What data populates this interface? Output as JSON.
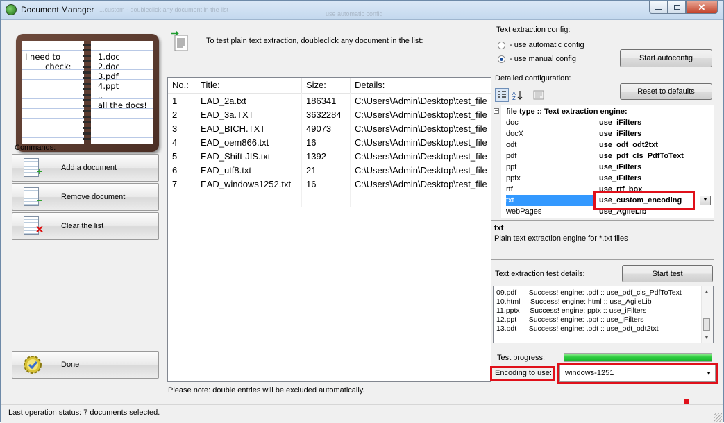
{
  "window": {
    "title": "Document Manager",
    "ghost_title_text": "...custom - doubleclick any document in the list",
    "ghost_option_text": "use automatic config"
  },
  "book": {
    "left_lines": [
      "I need to",
      "check:"
    ],
    "right_lines": [
      "1.doc",
      "2.doc",
      "3.pdf",
      "4.ppt",
      "..",
      "all the docs!"
    ]
  },
  "commands": {
    "label": "Commands:",
    "buttons": [
      {
        "label": "Add a document",
        "icon": "add-document-icon"
      },
      {
        "label": "Remove document",
        "icon": "remove-document-icon"
      },
      {
        "label": "Clear the list",
        "icon": "clear-list-icon"
      }
    ],
    "done_label": "Done"
  },
  "hint": "To test plain text extraction, doubleclick any document in the list:",
  "table": {
    "columns": [
      "No.:",
      "Title:",
      "Size:",
      "Details:"
    ],
    "rows": [
      {
        "no": "1",
        "title": "EAD_2a.txt",
        "size": "186341",
        "details": "C:\\Users\\Admin\\Desktop\\test_file"
      },
      {
        "no": "2",
        "title": "EAD_3a.TXT",
        "size": "3632284",
        "details": "C:\\Users\\Admin\\Desktop\\test_file"
      },
      {
        "no": "3",
        "title": "EAD_BICH.TXT",
        "size": "49073",
        "details": "C:\\Users\\Admin\\Desktop\\test_file"
      },
      {
        "no": "4",
        "title": "EAD_oem866.txt",
        "size": "16",
        "details": "C:\\Users\\Admin\\Desktop\\test_file"
      },
      {
        "no": "5",
        "title": "EAD_Shift-JIS.txt",
        "size": "1392",
        "details": "C:\\Users\\Admin\\Desktop\\test_file"
      },
      {
        "no": "6",
        "title": "EAD_utf8.txt",
        "size": "21",
        "details": "C:\\Users\\Admin\\Desktop\\test_file"
      },
      {
        "no": "7",
        "title": "EAD_windows1252.txt",
        "size": "16",
        "details": "C:\\Users\\Admin\\Desktop\\test_file"
      }
    ]
  },
  "note": "Please note: double entries will be excluded automatically.",
  "config": {
    "group_label": "Text extraction config:",
    "option_auto": "- use automatic config",
    "option_manual": "- use manual config",
    "selected": "manual",
    "start_autoconfig": "Start autoconfig",
    "detailed_label": "Detailed configuration:",
    "reset_label": "Reset to defaults"
  },
  "grid": {
    "category": "file type :: Text extraction engine:",
    "rows": [
      {
        "key": "doc",
        "value": "use_iFilters"
      },
      {
        "key": "docX",
        "value": "use_iFilters"
      },
      {
        "key": "odt",
        "value": "use_odt_odt2txt"
      },
      {
        "key": "pdf",
        "value": "use_pdf_cls_PdfToText"
      },
      {
        "key": "ppt",
        "value": "use_iFilters"
      },
      {
        "key": "pptx",
        "value": "use_iFilters"
      },
      {
        "key": "rtf",
        "value": "use_rtf_box"
      },
      {
        "key": "txt",
        "value": "use_custom_encoding"
      },
      {
        "key": "webPages",
        "value": "use_AgileLib"
      }
    ],
    "selected_key": "txt"
  },
  "description": {
    "title": "txt",
    "text": "Plain text extraction engine for *.txt files"
  },
  "test": {
    "label": "Text extraction test details:",
    "button": "Start test",
    "log": [
      "09.pdf      Success! engine: .pdf :: use_pdf_cls_PdfToText",
      "10.html     Success! engine: html :: use_AgileLib",
      "11.pptx     Success! engine: pptx :: use_iFilters",
      "12.ppt      Success! engine: .ppt :: use_iFilters",
      "13.odt      Success! engine: .odt :: use_odt_odt2txt"
    ],
    "progress_label": "Test progress:",
    "progress_value": 1.0
  },
  "encoding": {
    "label": "Encoding to use:",
    "value": "windows-1251"
  },
  "status": "Last operation status:  7 documents selected.",
  "colors": {
    "highlight_red": "#e0101a",
    "selection_blue": "#3399ff",
    "progress_green": "#2ecc40"
  }
}
